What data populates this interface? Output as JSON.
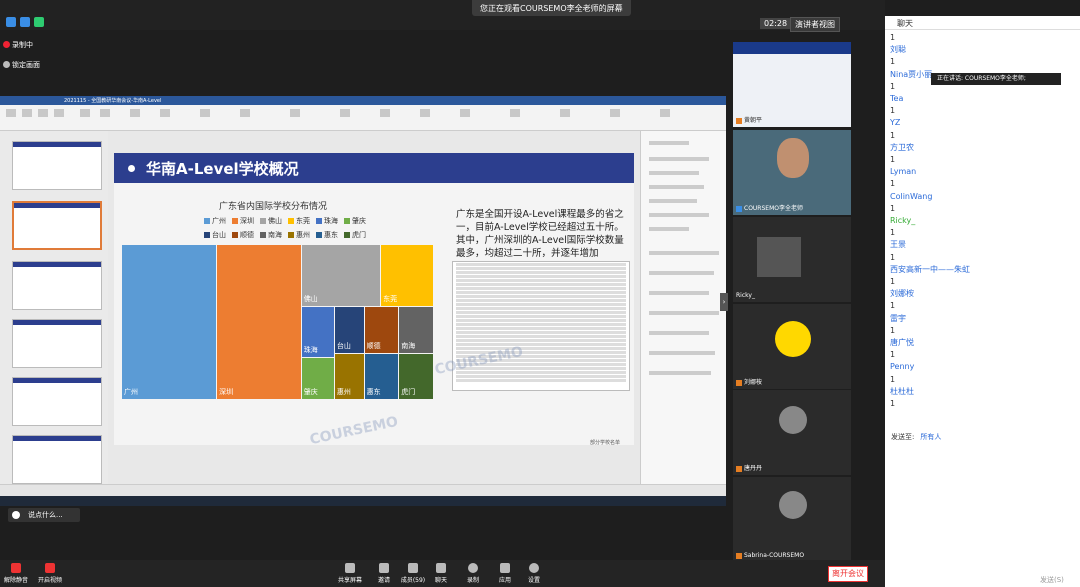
{
  "app": {
    "share_banner": "您正在观看COURSEMO李全老师的屏幕",
    "timer": "02:28",
    "view_label": "演讲者视图"
  },
  "left_controls": {
    "recording": "录制中",
    "pin_screen": "锁定画面"
  },
  "ppt": {
    "tab_name": "2021115 - 全国教研华南会议-华南A-Level",
    "slide_title": "华南A-Level学校概况",
    "chart_title": "广东省内国际学校分布情况",
    "body_text": "广东是全国开设A-Level课程最多的省之一，目前A-Level学校已经超过五十所。其中，广州深圳的A-Level国际学校数量最多，均超过二十所，并逐年增加",
    "caption": "部分学校名单",
    "watermark": "COURSEMO"
  },
  "chart_data": {
    "type": "treemap",
    "title": "广东省内国际学校分布情况",
    "categories": [
      "广州",
      "深圳",
      "佛山",
      "东莞",
      "珠海",
      "肇庆",
      "台山",
      "顺德",
      "南海",
      "惠州",
      "惠东",
      "虎门"
    ],
    "series": [
      {
        "values": [
          9,
          8,
          3,
          2,
          1.5,
          1,
          1,
          1,
          1,
          1,
          0.5,
          0.5
        ]
      }
    ],
    "colors": [
      "#5b9bd5",
      "#ed7d31",
      "#a5a5a5",
      "#ffc000",
      "#4472c4",
      "#70ad47",
      "#264478",
      "#9e480e",
      "#636363",
      "#997300",
      "#255e91",
      "#43682b"
    ]
  },
  "videos": [
    {
      "name": "黄朝平"
    },
    {
      "name": "COURSEMO李全老师"
    },
    {
      "name": "Ricky_"
    },
    {
      "name": "刘娜桉"
    },
    {
      "name": "唐丹丹"
    },
    {
      "name": "Sabrina-COURSEMO"
    }
  ],
  "chat": {
    "title": "聊天",
    "tooltip": "正在讲话: COURSEMO李全老师;",
    "messages": [
      {
        "t": "1"
      },
      {
        "t": "刘聪",
        "n": 1
      },
      {
        "t": "1"
      },
      {
        "t": "Nina贾小丽",
        "n": 1
      },
      {
        "t": "1"
      },
      {
        "t": "Tea",
        "n": 1
      },
      {
        "t": "1"
      },
      {
        "t": "YZ",
        "n": 1
      },
      {
        "t": "1"
      },
      {
        "t": "方卫农",
        "n": 1
      },
      {
        "t": "1"
      },
      {
        "t": "Lyman",
        "n": 1
      },
      {
        "t": "1"
      },
      {
        "t": "ColinWang",
        "n": 1
      },
      {
        "t": "1"
      },
      {
        "t": "Ricky_",
        "g": 1
      },
      {
        "t": "1"
      },
      {
        "t": "王景",
        "n": 1
      },
      {
        "t": "1"
      },
      {
        "t": "西安高新一中——朱虹",
        "n": 1
      },
      {
        "t": "1"
      },
      {
        "t": "刘娜桉",
        "n": 1
      },
      {
        "t": "1"
      },
      {
        "t": "雷宇",
        "n": 1
      },
      {
        "t": "1"
      },
      {
        "t": "唐广悦",
        "n": 1
      },
      {
        "t": "1"
      },
      {
        "t": "Penny",
        "n": 1
      },
      {
        "t": "1"
      },
      {
        "t": "杜杜杜",
        "n": 1
      },
      {
        "t": "1"
      }
    ],
    "send_to_label": "发送至:",
    "recipient": "所有人",
    "footer": "发送(S)"
  },
  "chat_prompt": "说点什么...",
  "bottom": {
    "mute": "解除静音",
    "video": "开启视频",
    "share": "共享屏幕",
    "invite": "邀请",
    "members": "成员(59)",
    "chat": "聊天",
    "record": "录制",
    "apps": "应用",
    "settings": "设置",
    "leave": "离开会议"
  }
}
